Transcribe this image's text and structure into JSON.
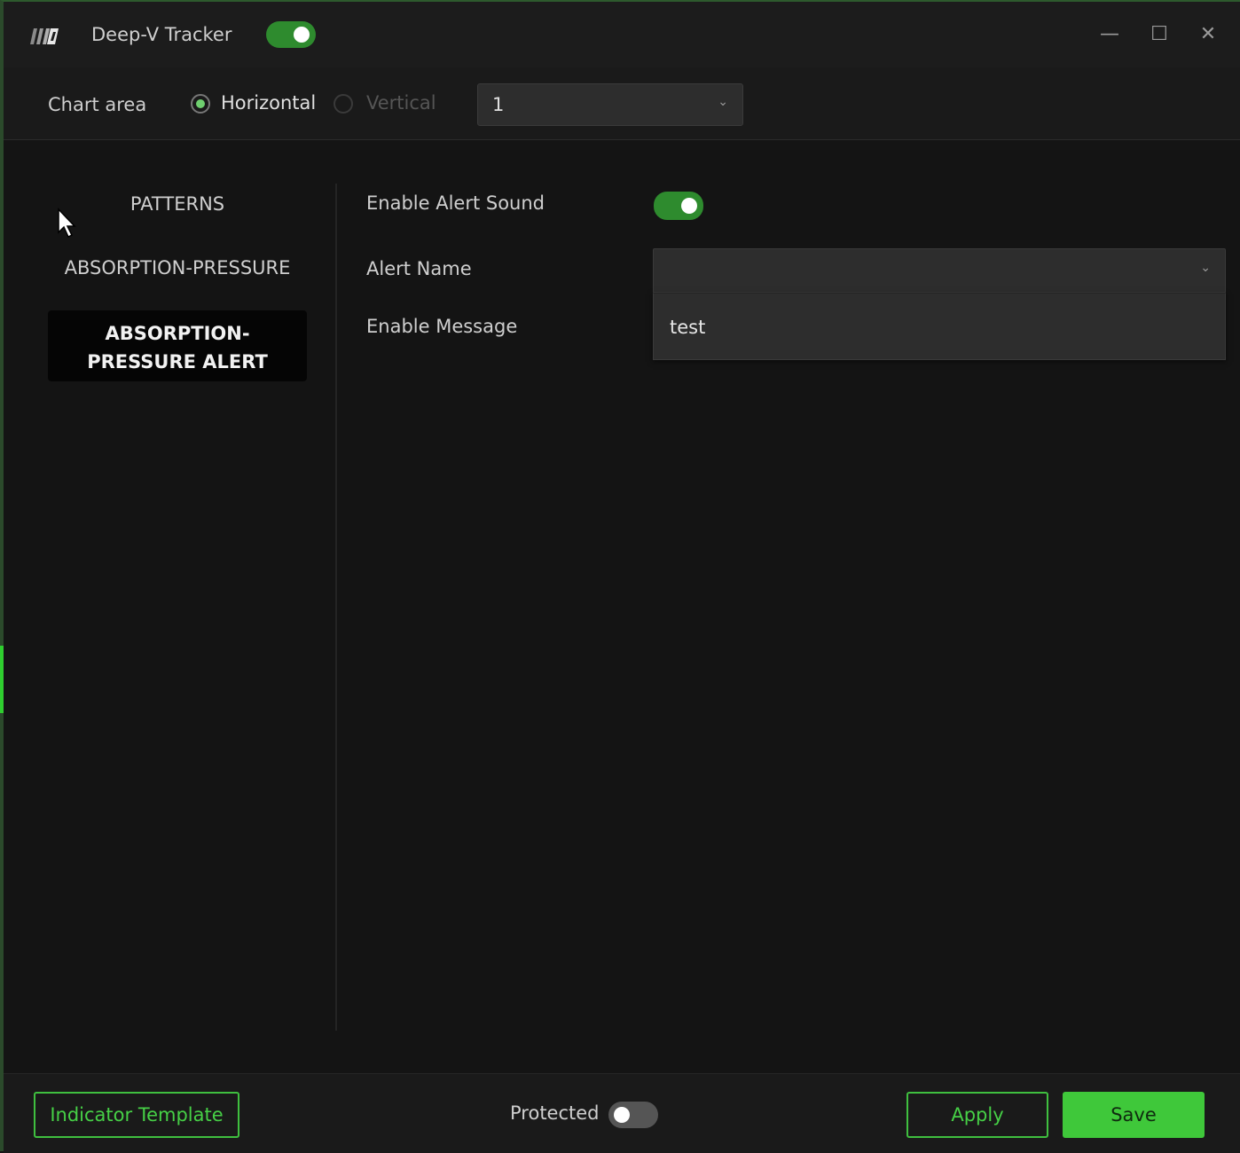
{
  "window": {
    "title": "Deep-V Tracker",
    "enabled": true,
    "controls": {
      "minimize": "—",
      "maximize": "☐",
      "close": "✕"
    }
  },
  "chart_area": {
    "label": "Chart area",
    "orientation_options": [
      {
        "label": "Horizontal",
        "selected": true
      },
      {
        "label": "Vertical",
        "selected": false
      }
    ],
    "selected_value": "1"
  },
  "nav": {
    "items": [
      {
        "label": "PATTERNS",
        "selected": false
      },
      {
        "label": "ABSORPTION-PRESSURE",
        "selected": false
      },
      {
        "label": "ABSORPTION-\nPRESSURE ALERT",
        "selected": true
      }
    ]
  },
  "settings": {
    "enable_alert_sound": {
      "label": "Enable Alert Sound",
      "value": true
    },
    "alert_name": {
      "label": "Alert Name",
      "value": "",
      "options": [
        "test"
      ]
    },
    "enable_message": {
      "label": "Enable Message"
    }
  },
  "footer": {
    "indicator_template_label": "Indicator Template",
    "protected_label": "Protected",
    "protected_value": false,
    "apply_label": "Apply",
    "save_label": "Save"
  },
  "colors": {
    "accent_green": "#3fc83a",
    "toggle_on": "#2e8b2e",
    "background": "#141414"
  }
}
